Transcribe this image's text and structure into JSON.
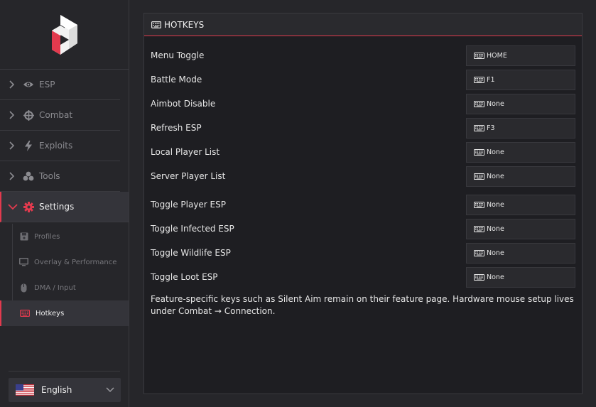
{
  "sidebar": {
    "nav": [
      {
        "label": "ESP",
        "icon": "eye-icon",
        "active": false
      },
      {
        "label": "Combat",
        "icon": "crosshair-icon",
        "active": false
      },
      {
        "label": "Exploits",
        "icon": "bolt-icon",
        "active": false
      },
      {
        "label": "Tools",
        "icon": "cubes-icon",
        "active": false
      },
      {
        "label": "Settings",
        "icon": "gear-icon",
        "active": true
      }
    ],
    "sub": [
      {
        "label": "Profiles",
        "icon": "save-icon"
      },
      {
        "label": "Overlay & Performance",
        "icon": "monitor-icon"
      },
      {
        "label": "DMA / Input",
        "icon": "mouse-icon"
      },
      {
        "label": "Hotkeys",
        "icon": "keyboard-icon",
        "active": true
      }
    ],
    "language": "English"
  },
  "panel": {
    "title": "HOTKEYS",
    "rows": [
      {
        "label": "Menu Toggle",
        "key": "HOME"
      },
      {
        "label": "Battle Mode",
        "key": "F1"
      },
      {
        "label": "Aimbot Disable",
        "key": "None"
      },
      {
        "label": "Refresh ESP",
        "key": "F3"
      },
      {
        "label": "Local Player List",
        "key": "None"
      },
      {
        "label": "Server Player List",
        "key": "None"
      },
      {
        "label": "Toggle Player ESP",
        "key": "None"
      },
      {
        "label": "Toggle Infected ESP",
        "key": "None"
      },
      {
        "label": "Toggle Wildlife ESP",
        "key": "None"
      },
      {
        "label": "Toggle Loot ESP",
        "key": "None"
      }
    ],
    "note": "Feature-specific keys such as Silent Aim remain on their feature page. Hardware mouse setup lives under Combat → Connection."
  },
  "colors": {
    "accent": "#e23a4e",
    "background": "#26262a",
    "panel": "#1e1e22"
  }
}
